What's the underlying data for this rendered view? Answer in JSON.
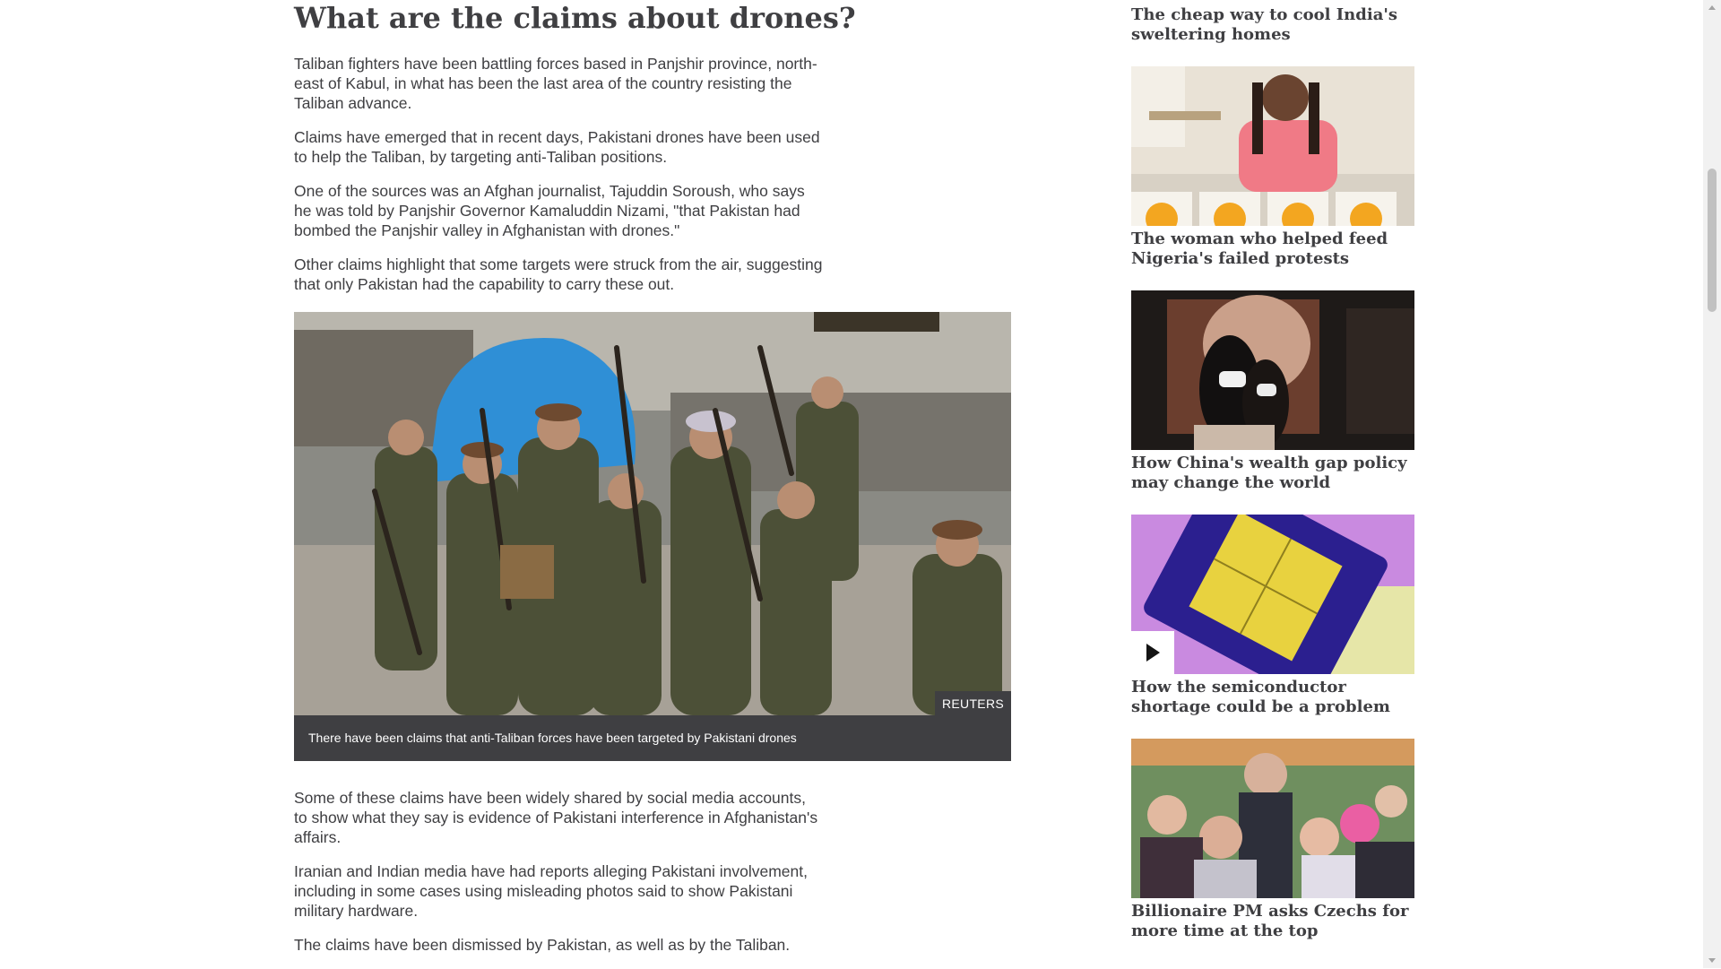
{
  "article": {
    "heading": "What are the claims about drones?",
    "paragraphs_top": [
      "Taliban fighters have been battling forces based in Panjshir province, north-east of Kabul, in what has been the last area of the country resisting the Taliban advance.",
      "Claims have emerged that in recent days, Pakistani drones have been used to help the Taliban, by targeting anti-Taliban positions.",
      "One of the sources was an Afghan journalist, Tajuddin Soroush, who says he was told by Panjshir Governor Kamaluddin Nizami, \"that Pakistan had bombed the Panjshir valley in Afghanistan with drones.\"",
      "Other claims highlight that some targets were struck from the air, suggesting that only Pakistan had the capability to carry these out."
    ],
    "figure": {
      "credit": "REUTERS",
      "caption": "There have been claims that anti-Taliban forces have been targeted by Pakistani drones"
    },
    "paragraphs_bottom": [
      "Some of these claims have been widely shared by social media accounts, to show what they say is evidence of Pakistani interference in Afghanistan's affairs.",
      "Iranian and Indian media have had reports alleging Pakistani involvement, including in some cases using misleading photos said to show Pakistani military hardware.",
      "The claims have been dismissed by Pakistan, as well as by the Taliban."
    ]
  },
  "sidebar": {
    "promos": [
      {
        "title": "The cheap way to cool India's sweltering homes"
      },
      {
        "title": "The woman who helped feed Nigeria's failed protests"
      },
      {
        "title": "How China's wealth gap policy may change the world"
      },
      {
        "title": "How the semiconductor shortage could be a problem"
      },
      {
        "title": "Billionaire PM asks Czechs for more time at the top"
      }
    ]
  }
}
